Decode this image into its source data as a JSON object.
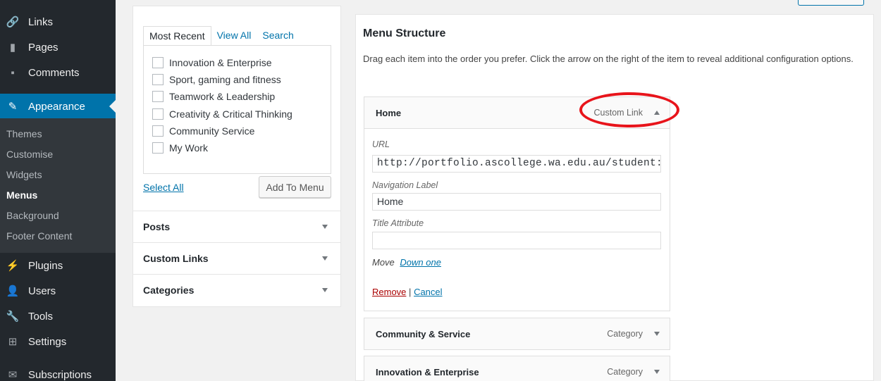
{
  "sidebar": {
    "items": [
      {
        "label": "Links",
        "icon": "link-icon",
        "glyph": "🔗"
      },
      {
        "label": "Pages",
        "icon": "pages-icon",
        "glyph": "▮"
      },
      {
        "label": "Comments",
        "icon": "comments-icon",
        "glyph": "▪"
      },
      {
        "label": "Appearance",
        "icon": "appearance-icon",
        "glyph": "✎",
        "active": true
      },
      {
        "label": "Plugins",
        "icon": "plugins-icon",
        "glyph": "⚡"
      },
      {
        "label": "Users",
        "icon": "users-icon",
        "glyph": "👤"
      },
      {
        "label": "Tools",
        "icon": "tools-icon",
        "glyph": "🔧"
      },
      {
        "label": "Settings",
        "icon": "settings-icon",
        "glyph": "⊞"
      },
      {
        "label": "Subscriptions",
        "icon": "subscriptions-icon",
        "glyph": "✉"
      }
    ],
    "submenu": [
      "Themes",
      "Customise",
      "Widgets",
      "Menus",
      "Background",
      "Footer Content"
    ],
    "current_submenu": "Menus"
  },
  "left_panel": {
    "tabs": [
      "Most Recent",
      "View All",
      "Search"
    ],
    "items": [
      "Innovation & Enterprise",
      "Sport, gaming and fitness",
      "Teamwork & Leadership",
      "Creativity & Critical Thinking",
      "Community Service",
      "My Work"
    ],
    "select_all": "Select All",
    "add_to_menu": "Add To Menu",
    "sections": [
      "Posts",
      "Custom Links",
      "Categories"
    ]
  },
  "menu_structure": {
    "title": "Menu Structure",
    "description": "Drag each item into the order you prefer. Click the arrow on the right of the item to reveal additional configuration options.",
    "expanded_item": {
      "title": "Home",
      "type": "Custom Link",
      "url_label": "URL",
      "url_value": "http://portfolio.ascollege.wa.edu.au/student:",
      "nav_label_label": "Navigation Label",
      "nav_label_value": "Home",
      "title_attr_label": "Title Attribute",
      "title_attr_value": "",
      "move_label": "Move",
      "move_link": "Down one",
      "remove": "Remove",
      "separator": "|",
      "cancel": "Cancel"
    },
    "collapsed_items": [
      {
        "title": "Community & Service",
        "type": "Category"
      },
      {
        "title": "Innovation & Enterprise",
        "type": "Category"
      }
    ]
  },
  "colors": {
    "sidebar_bg": "#23282d",
    "active_bg": "#0073aa",
    "link": "#0073aa",
    "remove": "#aa0000",
    "annotation_circle": "#e8141b"
  }
}
